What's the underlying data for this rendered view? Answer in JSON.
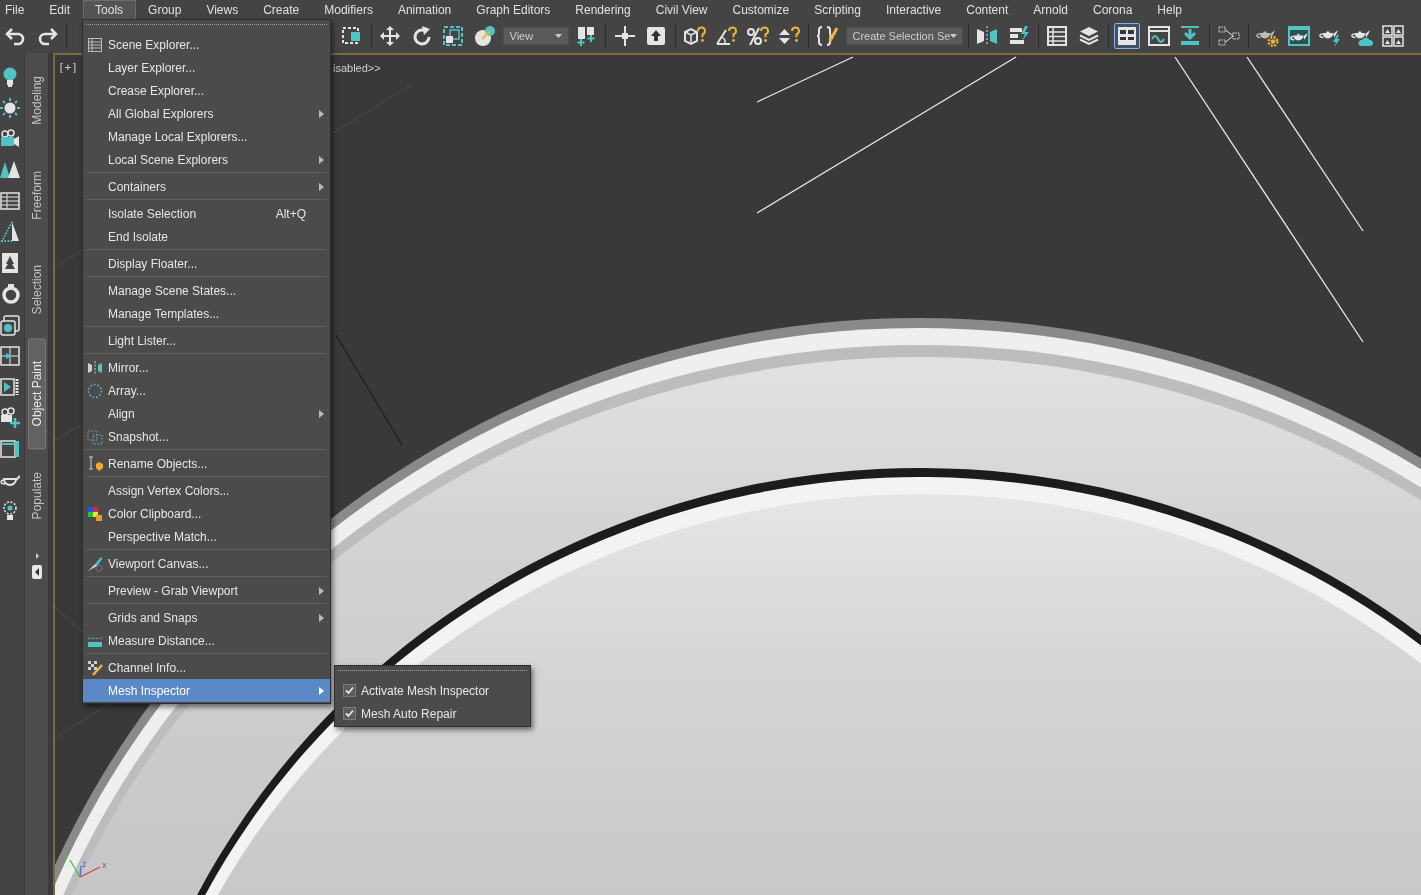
{
  "menu_bar": [
    {
      "label": "File",
      "selected": false
    },
    {
      "label": "Edit",
      "selected": false
    },
    {
      "label": "Tools",
      "selected": true
    },
    {
      "label": "Group",
      "selected": false
    },
    {
      "label": "Views",
      "selected": false
    },
    {
      "label": "Create",
      "selected": false
    },
    {
      "label": "Modifiers",
      "selected": false
    },
    {
      "label": "Animation",
      "selected": false
    },
    {
      "label": "Graph Editors",
      "selected": false
    },
    {
      "label": "Rendering",
      "selected": false
    },
    {
      "label": "Civil View",
      "selected": false
    },
    {
      "label": "Customize",
      "selected": false
    },
    {
      "label": "Scripting",
      "selected": false
    },
    {
      "label": "Interactive",
      "selected": false
    },
    {
      "label": "Content",
      "selected": false
    },
    {
      "label": "Arnold",
      "selected": false
    },
    {
      "label": "Corona",
      "selected": false
    },
    {
      "label": "Help",
      "selected": false
    }
  ],
  "toolbar": {
    "buttons": [
      {
        "selected": false
      },
      {
        "selected": false
      },
      {
        "selected": false
      },
      {
        "selected": false
      },
      {
        "selected": false
      },
      {
        "selected": false
      },
      {
        "selected": false
      },
      {
        "selected": false
      },
      {
        "selected": false
      },
      {
        "selected": false
      },
      {
        "selected": false
      },
      {
        "selected": false
      },
      {
        "selected": false
      },
      {
        "selected": false
      },
      {
        "selected": false
      },
      {
        "selected": false
      },
      {
        "selected": false
      },
      {
        "selected": false
      },
      {
        "selected": false
      },
      {
        "selected": true
      },
      {
        "selected": false
      },
      {
        "selected": false
      },
      {
        "selected": false
      },
      {
        "selected": false
      },
      {
        "selected": false
      },
      {
        "selected": false
      },
      {
        "selected": false
      },
      {
        "selected": false
      }
    ],
    "dropdowns": [
      {
        "value": "View"
      },
      {
        "value": "Create Selection Se"
      }
    ]
  },
  "command_panel_tabs": [
    {
      "label": "Modeling",
      "selected": false
    },
    {
      "label": "Freeform",
      "selected": false
    },
    {
      "label": "Selection",
      "selected": false
    },
    {
      "label": "Object Paint",
      "selected": true
    },
    {
      "label": "Populate",
      "selected": false
    }
  ],
  "viewport": {
    "view_menu": "[+]",
    "viewport_label": "isabled>>",
    "axis_labels": [
      "y",
      "z",
      "x"
    ]
  },
  "tools_menu": {
    "sections": [
      {
        "items": [
          {
            "label": "Scene Explorer...",
            "has_submenu": false,
            "selected": false
          },
          {
            "label": "Layer Explorer...",
            "has_submenu": false,
            "selected": false
          },
          {
            "label": "Crease Explorer...",
            "has_submenu": false,
            "selected": false
          },
          {
            "label": "All Global Explorers",
            "has_submenu": true,
            "selected": false
          },
          {
            "label": "Manage Local Explorers...",
            "has_submenu": false,
            "selected": false
          },
          {
            "label": "Local Scene Explorers",
            "has_submenu": true,
            "selected": false
          }
        ]
      },
      {
        "items": [
          {
            "label": "Containers",
            "has_submenu": true,
            "selected": false
          }
        ]
      },
      {
        "items": [
          {
            "label": "Isolate Selection",
            "shortcut": "Alt+Q",
            "has_submenu": false,
            "selected": false
          },
          {
            "label": "End Isolate",
            "has_submenu": false,
            "selected": false
          }
        ]
      },
      {
        "items": [
          {
            "label": "Display Floater...",
            "has_submenu": false,
            "selected": false
          }
        ]
      },
      {
        "items": [
          {
            "label": "Manage Scene States...",
            "has_submenu": false,
            "selected": false
          },
          {
            "label": "Manage Templates...",
            "has_submenu": false,
            "selected": false
          }
        ]
      },
      {
        "items": [
          {
            "label": "Light Lister...",
            "has_submenu": false,
            "selected": false
          }
        ]
      },
      {
        "items": [
          {
            "label": "Mirror...",
            "has_submenu": false,
            "selected": false
          },
          {
            "label": "Array...",
            "has_submenu": false,
            "selected": false
          },
          {
            "label": "Align",
            "has_submenu": true,
            "selected": false
          },
          {
            "label": "Snapshot...",
            "has_submenu": false,
            "selected": false
          }
        ]
      },
      {
        "items": [
          {
            "label": "Rename Objects...",
            "has_submenu": false,
            "selected": false
          }
        ]
      },
      {
        "items": [
          {
            "label": "Assign Vertex Colors...",
            "has_submenu": false,
            "selected": false
          },
          {
            "label": "Color Clipboard...",
            "has_submenu": false,
            "selected": false
          },
          {
            "label": "Perspective Match...",
            "has_submenu": false,
            "selected": false
          }
        ]
      },
      {
        "items": [
          {
            "label": "Viewport Canvas...",
            "has_submenu": false,
            "selected": false
          }
        ]
      },
      {
        "items": [
          {
            "label": "Preview - Grab Viewport",
            "has_submenu": true,
            "selected": false
          }
        ]
      },
      {
        "items": [
          {
            "label": "Grids and Snaps",
            "has_submenu": true,
            "selected": false
          },
          {
            "label": "Measure Distance...",
            "has_submenu": false,
            "selected": false
          }
        ]
      },
      {
        "items": [
          {
            "label": "Channel Info...",
            "has_submenu": false,
            "selected": false
          },
          {
            "label": "Mesh Inspector",
            "has_submenu": true,
            "selected": true
          }
        ]
      }
    ]
  },
  "mesh_inspector_submenu": {
    "items": [
      {
        "label": "Activate Mesh Inspector",
        "checked": true
      },
      {
        "label": "Mesh Auto Repair",
        "checked": true
      }
    ]
  }
}
